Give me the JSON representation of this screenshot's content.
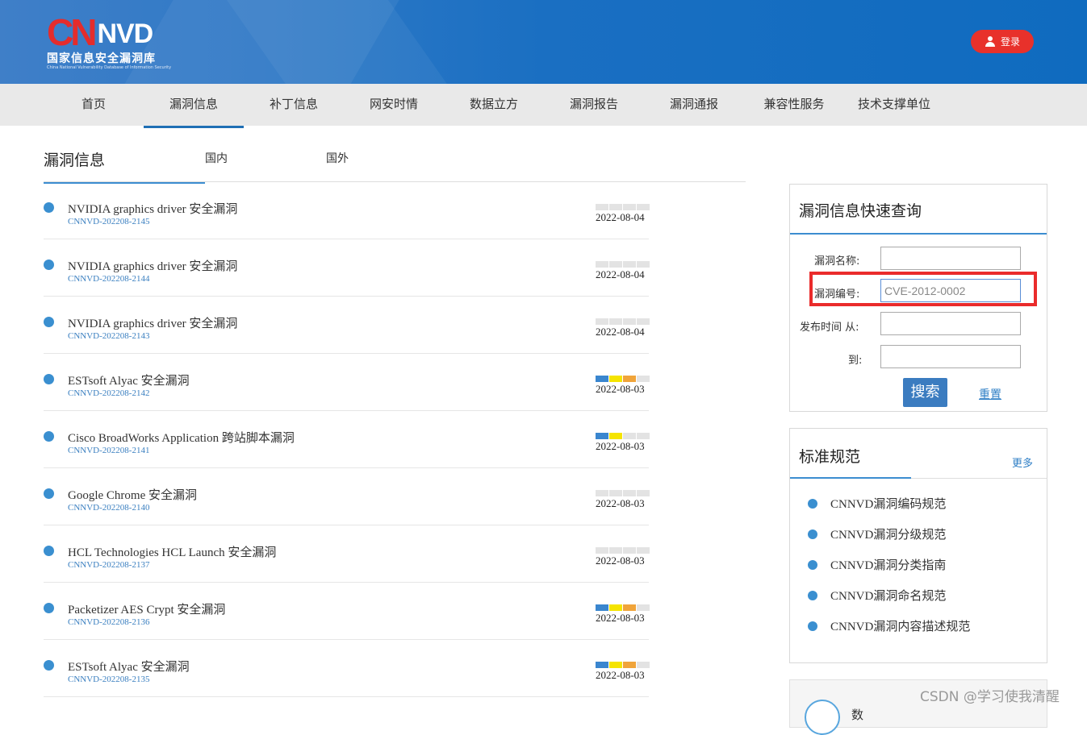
{
  "logo": {
    "mark_c": "CN",
    "mark_rest": "NVD",
    "name_cn": "国家信息安全漏洞库",
    "name_en": "China National Vulnerability Database of Information Security"
  },
  "header": {
    "login_label": "登录"
  },
  "nav": {
    "items": [
      "首页",
      "漏洞信息",
      "补丁信息",
      "网安时情",
      "数据立方",
      "漏洞报告",
      "漏洞通报",
      "兼容性服务",
      "技术支撑单位"
    ],
    "active": "漏洞信息"
  },
  "tabs": {
    "title": "漏洞信息",
    "domestic": "国内",
    "foreign": "国外"
  },
  "vulns": [
    {
      "title": "NVIDIA graphics driver 安全漏洞",
      "id": "CNNVD-202208-2145",
      "date": "2022-08-04",
      "severity": [
        "#e3e3e3",
        "#e3e3e3",
        "#e3e3e3",
        "#e3e3e3"
      ]
    },
    {
      "title": "NVIDIA graphics driver 安全漏洞",
      "id": "CNNVD-202208-2144",
      "date": "2022-08-04",
      "severity": [
        "#e3e3e3",
        "#e3e3e3",
        "#e3e3e3",
        "#e3e3e3"
      ]
    },
    {
      "title": "NVIDIA graphics driver 安全漏洞",
      "id": "CNNVD-202208-2143",
      "date": "2022-08-04",
      "severity": [
        "#e3e3e3",
        "#e3e3e3",
        "#e3e3e3",
        "#e3e3e3"
      ]
    },
    {
      "title": "ESTsoft Alyac 安全漏洞",
      "id": "CNNVD-202208-2142",
      "date": "2022-08-03",
      "severity": [
        "#3a86cf",
        "#f5e400",
        "#f0a43a",
        "#e3e3e3"
      ]
    },
    {
      "title": "Cisco BroadWorks Application 跨站脚本漏洞",
      "id": "CNNVD-202208-2141",
      "date": "2022-08-03",
      "severity": [
        "#3a86cf",
        "#f5e400",
        "#e3e3e3",
        "#e3e3e3"
      ]
    },
    {
      "title": "Google Chrome 安全漏洞",
      "id": "CNNVD-202208-2140",
      "date": "2022-08-03",
      "severity": [
        "#e3e3e3",
        "#e3e3e3",
        "#e3e3e3",
        "#e3e3e3"
      ]
    },
    {
      "title": "HCL Technologies HCL Launch 安全漏洞",
      "id": "CNNVD-202208-2137",
      "date": "2022-08-03",
      "severity": [
        "#e3e3e3",
        "#e3e3e3",
        "#e3e3e3",
        "#e3e3e3"
      ]
    },
    {
      "title": "Packetizer AES Crypt 安全漏洞",
      "id": "CNNVD-202208-2136",
      "date": "2022-08-03",
      "severity": [
        "#3a86cf",
        "#f5e400",
        "#f0a43a",
        "#e3e3e3"
      ]
    },
    {
      "title": "ESTsoft Alyac 安全漏洞",
      "id": "CNNVD-202208-2135",
      "date": "2022-08-03",
      "severity": [
        "#3a86cf",
        "#f5e400",
        "#f0a43a",
        "#e3e3e3"
      ]
    }
  ],
  "search": {
    "title": "漏洞信息快速查询",
    "name_label": "漏洞名称:",
    "name_value": "",
    "id_label": "漏洞编号:",
    "id_value": "CVE-2012-0002",
    "time_label": "发布时间 从:",
    "time_from_value": "",
    "to_label": "到:",
    "time_to_value": "",
    "search_button": "搜索",
    "reset_link": "重置"
  },
  "standards": {
    "title": "标准规范",
    "more": "更多",
    "items": [
      "CNNVD漏洞编码规范",
      "CNNVD漏洞分级规范",
      "CNNVD漏洞分类指南",
      "CNNVD漏洞命名规范",
      "CNNVD漏洞内容描述规范"
    ]
  },
  "bottom_panel": {
    "partial_text": "数"
  },
  "watermark": "CSDN @学习使我清醒",
  "colors": {
    "header_blue": "#0f6bbf",
    "accent_blue": "#3c8dd0",
    "login_red": "#e8312b",
    "highlight_red": "#ea2b2b"
  }
}
